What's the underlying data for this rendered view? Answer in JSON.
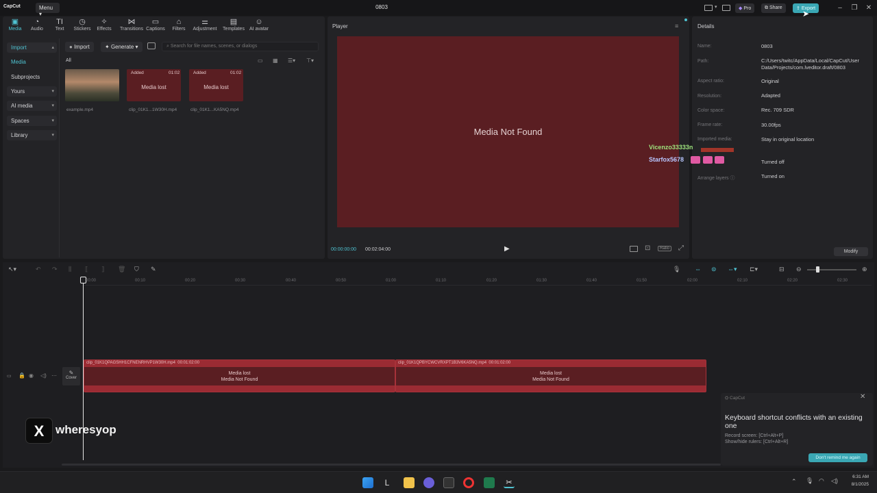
{
  "titlebar": {
    "logo": "CapCut",
    "menu": "Menu",
    "title": "0803",
    "pro": "Pro",
    "share": "Share",
    "export": "Export"
  },
  "toolbar": {
    "items": [
      "Media",
      "Audio",
      "Text",
      "Stickers",
      "Effects",
      "Transitions",
      "Captions",
      "Filters",
      "Adjustment",
      "Templates",
      "AI avatar"
    ]
  },
  "leftnav": {
    "import": "Import",
    "media": "Media",
    "subprojects": "Subprojects",
    "yours": "Yours",
    "ai_media": "AI media",
    "spaces": "Spaces",
    "library": "Library"
  },
  "media": {
    "import_btn": "Import",
    "generate_btn": "Generate",
    "search_placeholder": "Search for file names, scenes, or dialogs",
    "filter_all": "All",
    "items": [
      {
        "label": "example.mp4",
        "lost": false,
        "badge": "",
        "duration": ""
      },
      {
        "label": "clip_01K1...1W30H.mp4",
        "lost": true,
        "badge": "Added",
        "duration": "01:02",
        "text": "Media lost"
      },
      {
        "label": "clip_01K1...KA5NQ.mp4",
        "lost": true,
        "badge": "Added",
        "duration": "01:02",
        "text": "Media lost"
      }
    ]
  },
  "player": {
    "title": "Player",
    "message": "Media Not Found",
    "time_current": "00:00:00:00",
    "time_total": "00:02:04:00",
    "ratio": "Ratio"
  },
  "details": {
    "title": "Details",
    "rows": [
      {
        "label": "Name:",
        "value": "0803"
      },
      {
        "label": "Path:",
        "value": "C:/Users/twitc/AppData/Local/CapCut/User Data/Projects/com.lveditor.draft/0803"
      },
      {
        "label": "Aspect ratio:",
        "value": "Original"
      },
      {
        "label": "Resolution:",
        "value": "Adapted"
      },
      {
        "label": "Color space:",
        "value": "Rec. 709 SDR"
      },
      {
        "label": "Frame rate:",
        "value": "30.00fps"
      },
      {
        "label": "Imported media:",
        "value": "Stay in original location"
      },
      {
        "label": "",
        "value": "Turned off"
      },
      {
        "label": "Arrange layers",
        "value": "Turned on"
      }
    ],
    "modify": "Modify"
  },
  "overlay": {
    "user1": "Vicenzo33333n",
    "user2": "Starfox5678",
    "watermark": "wheresyop"
  },
  "timeline": {
    "ruler": [
      "00:00",
      "00:10",
      "00:20",
      "00:30",
      "00:40",
      "00:50",
      "01:00",
      "01:10",
      "01:20",
      "01:30",
      "01:40",
      "01:50",
      "02:00",
      "02:10",
      "02:20",
      "02:30"
    ],
    "cover": "Cover",
    "clips": [
      {
        "name": "clip_01K1QPAGSHH1CFNENRHVP1W30H.mp4",
        "duration": "00:01:02:00",
        "line1": "Media lost",
        "line2": "Media Not Found"
      },
      {
        "name": "clip_01K1QPBYCWCVRXPT1B3V6KA5NQ.mp4",
        "duration": "00:01:02:00",
        "line1": "Media lost",
        "line2": "Media Not Found"
      }
    ]
  },
  "toast": {
    "app": "CapCut",
    "title": "Keyboard shortcut conflicts with an existing one",
    "line1": "Record screen: [Ctrl+Alt+P]",
    "line2": "Show/hide rulers: [Ctrl+Alt+R]",
    "button": "Don't remind me again"
  },
  "taskbar": {
    "time": "6:31 AM",
    "date": "8/1/2025"
  },
  "colors": {
    "accent": "#4fc3d2",
    "lost": "#5a1e22",
    "clip_border": "#a8323a"
  }
}
